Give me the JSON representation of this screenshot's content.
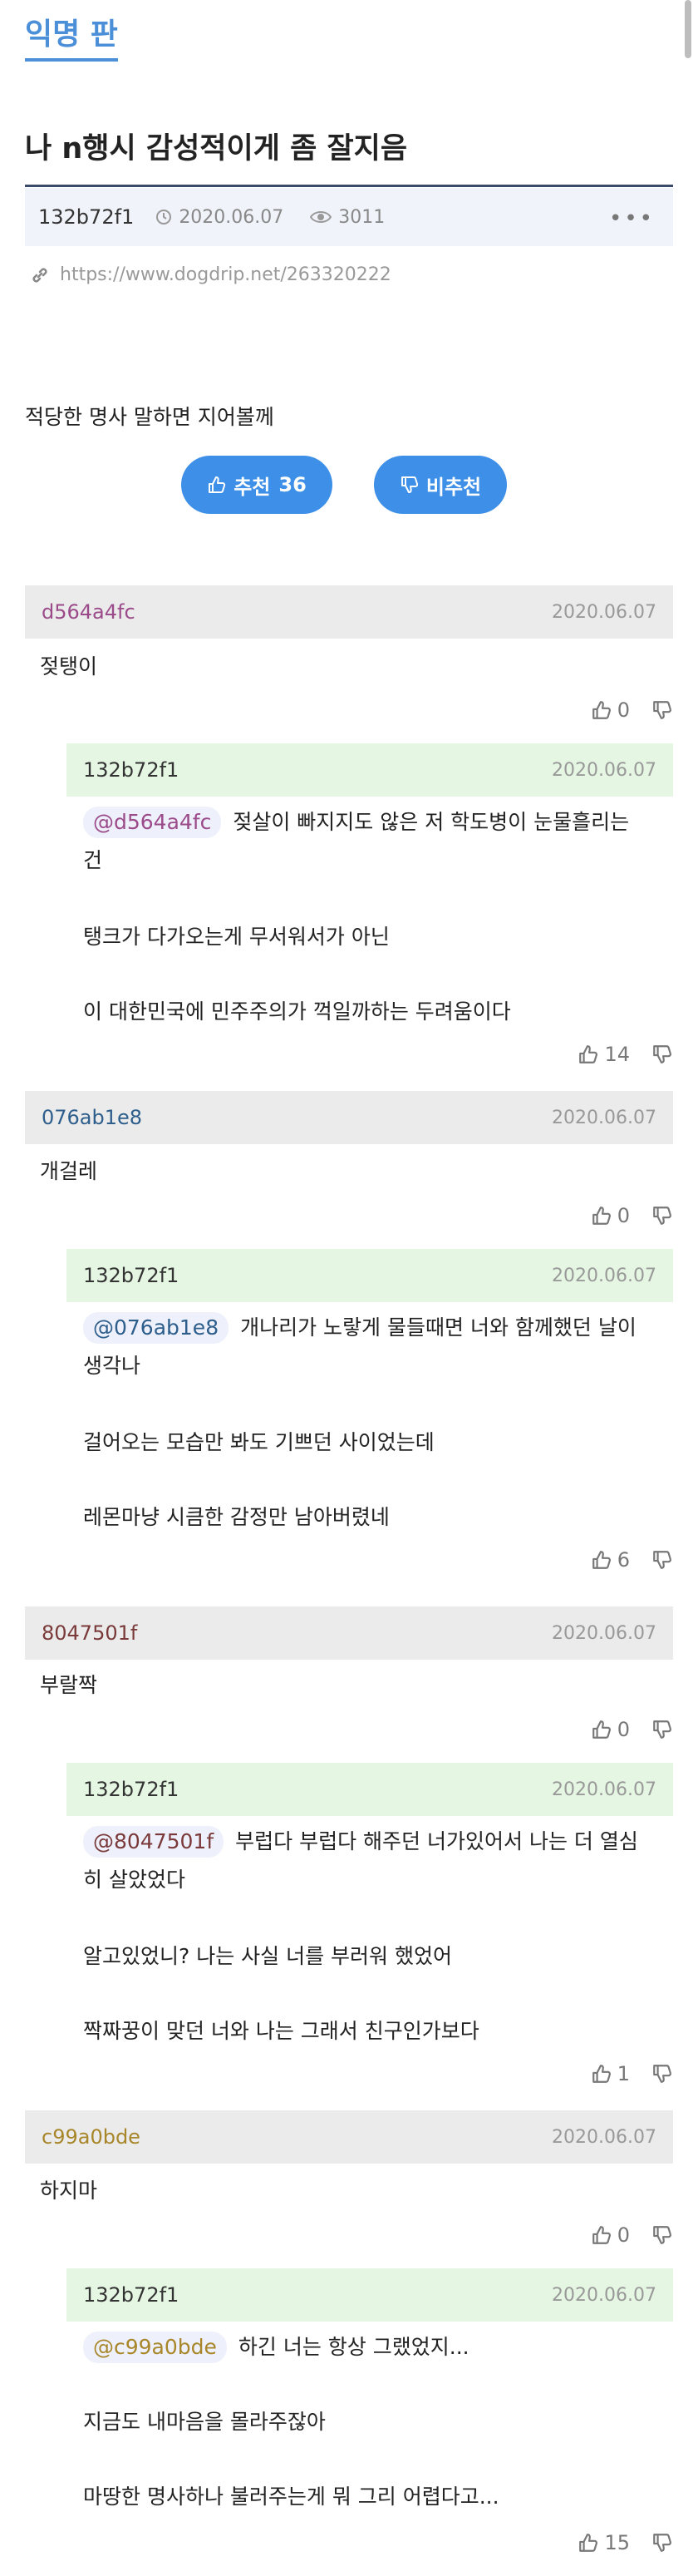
{
  "board": {
    "name": "익명 판"
  },
  "post": {
    "title": "나 n행시 감성적이게 좀 잘지음",
    "author": "132b72f1",
    "date": "2020.06.07",
    "views": "3011",
    "url": "https://www.dogdrip.net/263320222",
    "body": "적당한 명사 말하면 지어볼께",
    "upvote_label": "추천",
    "upvote_count": "36",
    "downvote_label": "비추천"
  },
  "comments": [
    {
      "author": "d564a4fc",
      "date": "2020.06.07",
      "text": "젖탱이",
      "up": "0",
      "reply": {
        "author": "132b72f1",
        "date": "2020.06.07",
        "mention": "@d564a4fc",
        "line1a": "젖살이 빠지지도 않은 저 학도병이 눈물흘리는",
        "line1b": "건",
        "line2": "탱크가 다가오는게 무서워서가 아닌",
        "line3": "이 대한민국에 민주주의가 꺽일까하는 두려움이다",
        "up": "14"
      }
    },
    {
      "author": "076ab1e8",
      "date": "2020.06.07",
      "text": "개걸레",
      "up": "0",
      "reply": {
        "author": "132b72f1",
        "date": "2020.06.07",
        "mention": "@076ab1e8",
        "line1a": "개나리가 노랗게 물들때면 너와 함께했던 날이",
        "line1b": "생각나",
        "line2": "걸어오는 모습만 봐도 기쁘던 사이었는데",
        "line3": "레몬마냥 시큼한 감정만 남아버렸네",
        "up": "6"
      }
    },
    {
      "author": "8047501f",
      "date": "2020.06.07",
      "text": "부랄짝",
      "up": "0",
      "reply": {
        "author": "132b72f1",
        "date": "2020.06.07",
        "mention": "@8047501f",
        "line1a": "부럽다 부럽다 해주던 너가있어서 나는 더 열심",
        "line1b": "히 살았었다",
        "line2": "알고있었니? 나는 사실 너를 부러워 했었어",
        "line3": "짝짜꿍이 맞던 너와 나는 그래서 친구인가보다",
        "up": "1"
      }
    },
    {
      "author": "c99a0bde",
      "date": "2020.06.07",
      "text": "하지마",
      "up": "0",
      "reply": {
        "author": "132b72f1",
        "date": "2020.06.07",
        "mention": "@c99a0bde",
        "line1a": "하긴 너는 항상 그랬었지...",
        "line1b": "",
        "line2": "지금도 내마음을 몰라주잖아",
        "line3": "마땅한 명사하나 불러주는게 뭐 그리 어렵다고...",
        "up": "15"
      }
    }
  ],
  "colors": {
    "accent": "#4a8fd8",
    "vote_button": "#3d8fe8",
    "comment_header": "#ebebeb",
    "reply_header": "#e5f7e3",
    "author_colors": [
      "#9b4a8a",
      "#2d5e8c",
      "#7a3a3a",
      "#a8862a"
    ]
  },
  "icons": [
    "clock-icon",
    "eye-icon",
    "more-icon",
    "link-icon",
    "thumb-up-icon",
    "thumb-down-icon"
  ]
}
